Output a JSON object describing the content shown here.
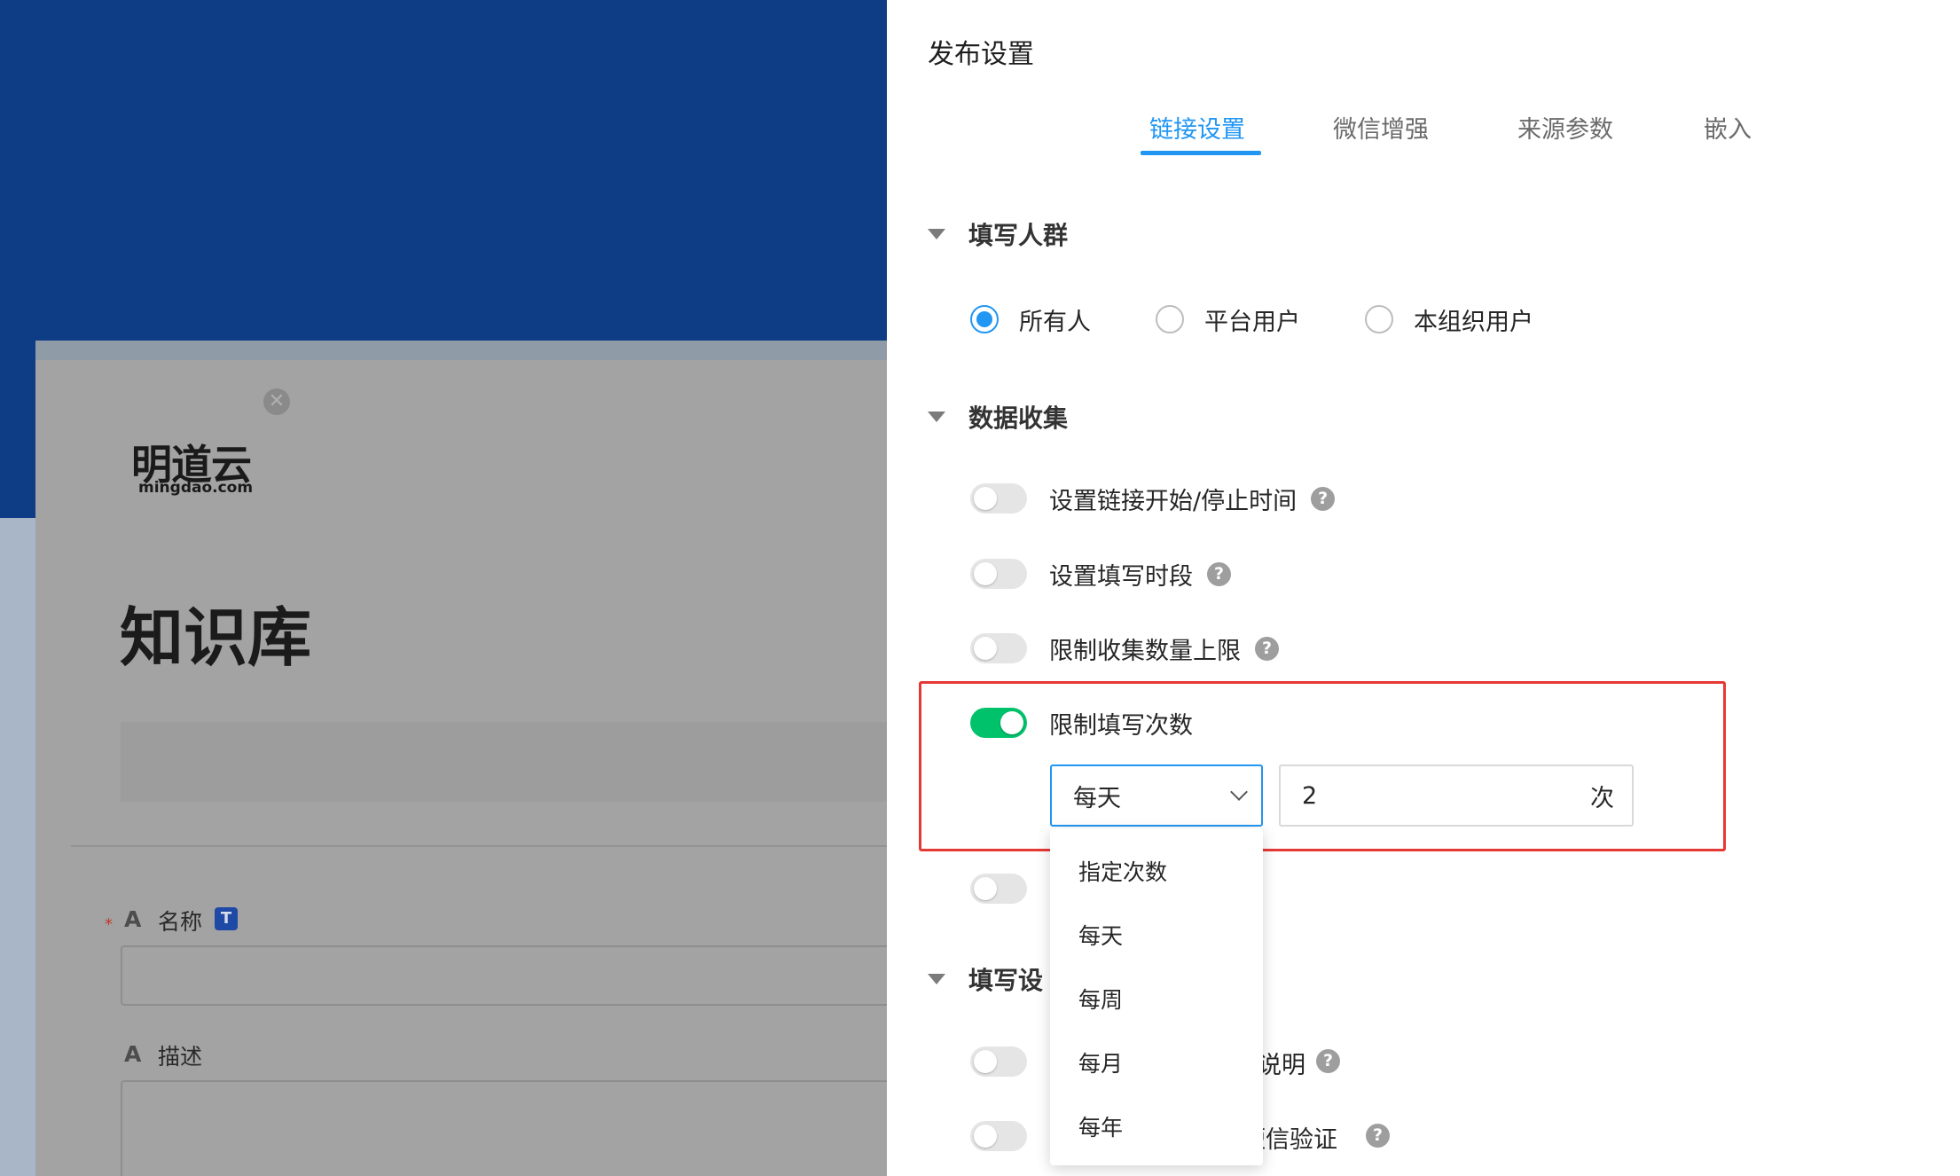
{
  "preview": {
    "brand_name": "明道云",
    "brand_domain": "mingdao.com",
    "close_glyph": "✕",
    "title": "知识库",
    "fields": [
      {
        "type_glyph": "A",
        "label": "名称",
        "required": "*",
        "badge": "T"
      },
      {
        "type_glyph": "A",
        "label": "描述"
      }
    ]
  },
  "panel": {
    "title": "发布设置",
    "tabs": [
      {
        "label": "链接设置",
        "active": true
      },
      {
        "label": "微信增强",
        "active": false
      },
      {
        "label": "来源参数",
        "active": false
      },
      {
        "label": "嵌入",
        "active": false
      }
    ],
    "sections": {
      "audience": {
        "heading": "填写人群",
        "options": [
          {
            "label": "所有人",
            "checked": true
          },
          {
            "label": "平台用户",
            "checked": false
          },
          {
            "label": "本组织用户",
            "checked": false
          }
        ]
      },
      "collection": {
        "heading": "数据收集",
        "toggles": [
          {
            "label": "设置链接开始/停止时间",
            "on": false,
            "help": "?"
          },
          {
            "label": "设置填写时段",
            "on": false,
            "help": "?"
          },
          {
            "label": "限制收集数量上限",
            "on": false,
            "help": "?"
          },
          {
            "label": "限制填写次数",
            "on": true
          }
        ],
        "limit": {
          "period_selected": "每天",
          "count_value": "2",
          "count_unit": "次",
          "period_options": [
            "指定次数",
            "每天",
            "每周",
            "每月",
            "每年"
          ]
        }
      },
      "fill_settings": {
        "heading_partial": "填写设",
        "row1_tail": "说明",
        "row2_tail": "短信验证",
        "help": "?"
      }
    }
  },
  "colors": {
    "accent": "#2196f3",
    "toggle_on": "#00c26b",
    "highlight": "#e53935",
    "banner": "#0e3d86"
  }
}
